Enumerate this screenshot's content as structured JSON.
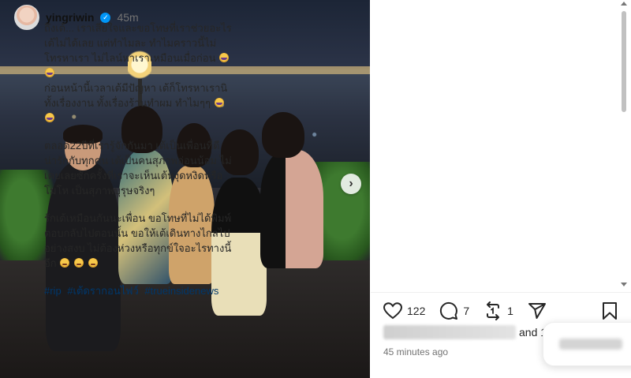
{
  "post": {
    "username": "yingriwin",
    "time_ago": "45m",
    "caption": [
      "ถึงเต้... เราเสียใจและขอโทษที่เราช่วยอะไรเต้ไม่ได้เลย แต่ทำไมละ ทำไมคราวนี้ไม่โทรหาเรา ไม่ไลน์หาเราเหมือนเมื่อก่อน",
      "ก่อนหน้านี้เวลาเต้มีปัญหา เต้ก็โทรหาเรานิทั้งเรื่องงาน ทั้งเรื่องร้านทำผม ทำไมๆๆ",
      "ตลอด22ปีที่เรารู้จักกันมา เต้เป็นเพื่อนที่ดี น่ารักกับทุกคน เต้เป็นคนสุภาพอ่อนน้อม ไม่เคยเลยซักครั้งที่เราจะเห็นเต้หงุดหงิดหรือโมโห เป็นสุภาพบุรุษจริงๆ",
      "รักเต้เหมือนกันนะเพื่อน ขอโทษที่ไม่ได้พิมพ์ตอบกลับไปตอนนั้น ขอให้เต้เดินทางไกลไปอย่างสงบ ไม่ต้องห่วงหรือทุกข์ใจอะไรทางนี้อีก"
    ],
    "hashtags": [
      "#rip",
      "#เต้ดรากอนไฟว์",
      "#trueinsidenews"
    ]
  },
  "actions": {
    "like_count": "122",
    "comment_count": "7",
    "repost_count": "1"
  },
  "likes_text": "and 1",
  "timestamp": "45 minutes ago",
  "icons": {
    "like": "heart-icon",
    "comment": "comment-icon",
    "repost": "repost-icon",
    "share": "share-icon",
    "save": "bookmark-icon",
    "next": "chevron-right-icon",
    "verified": "verified-badge-icon"
  },
  "colors": {
    "verified": "#0095f6",
    "hashtag": "#00376b",
    "text": "#262626",
    "muted": "#737373"
  }
}
